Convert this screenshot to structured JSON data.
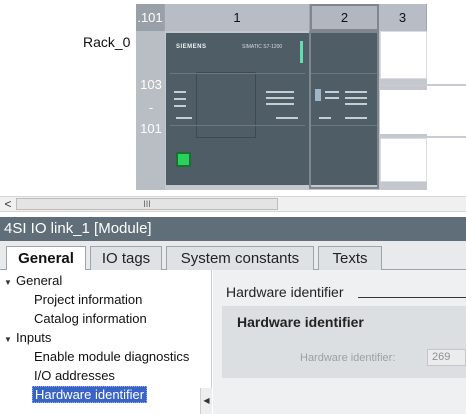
{
  "device_view": {
    "rack_name": "Rack_0",
    "slot_headers": [
      ".101",
      "1",
      "2",
      "3"
    ],
    "rail_numbers": [
      "103",
      "-",
      "101"
    ],
    "cpu_brand": "SIEMENS",
    "cpu_model": "SIMATIC S7-1200"
  },
  "scrollbar": {
    "left_arrow": "<",
    "thumb_grip": "III"
  },
  "inspector": {
    "title": "4SI IO link_1 [Module]",
    "tabs": [
      "General",
      "IO tags",
      "System constants",
      "Texts"
    ],
    "active_tab": "General",
    "nav": {
      "items": [
        {
          "label": "General",
          "level": 0,
          "expanded": true
        },
        {
          "label": "Project information",
          "level": 1
        },
        {
          "label": "Catalog information",
          "level": 1
        },
        {
          "label": "Inputs",
          "level": 0,
          "expanded": true
        },
        {
          "label": "Enable module diagnostics",
          "level": 1
        },
        {
          "label": "I/O addresses",
          "level": 1
        },
        {
          "label": "Hardware identifier",
          "level": 1,
          "selected": true
        }
      ]
    },
    "content": {
      "section_title": "Hardware identifier",
      "panel_title": "Hardware identifier",
      "field_label": "Hardware identifier:",
      "field_value": "269"
    }
  },
  "colors": {
    "title_bar": "#5f6e78",
    "selection": "#3a63c6",
    "module_body": "#4f5d66",
    "rail": "#b9bdc4"
  }
}
